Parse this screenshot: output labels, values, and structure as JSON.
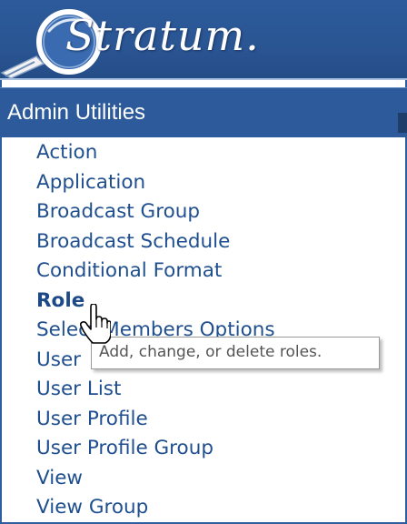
{
  "app": {
    "logo_text": "Stratum."
  },
  "section": {
    "title": "Admin Utilities"
  },
  "menu": {
    "items": [
      "Action",
      "Application",
      "Broadcast Group",
      "Broadcast Schedule",
      "Conditional Format",
      "Role",
      "Select Members Options",
      "User",
      "User List",
      "User Profile",
      "User Profile Group",
      "View",
      "View Group"
    ],
    "active_item": "Role"
  },
  "tooltip": {
    "text": "Add, change, or delete roles."
  },
  "colors": {
    "header_blue": "#2c5a9a",
    "link_blue": "#1f4f8f"
  },
  "icons": {
    "logo": "magnifying-glass-logo-icon",
    "cursor": "hand-pointer-cursor-icon"
  }
}
